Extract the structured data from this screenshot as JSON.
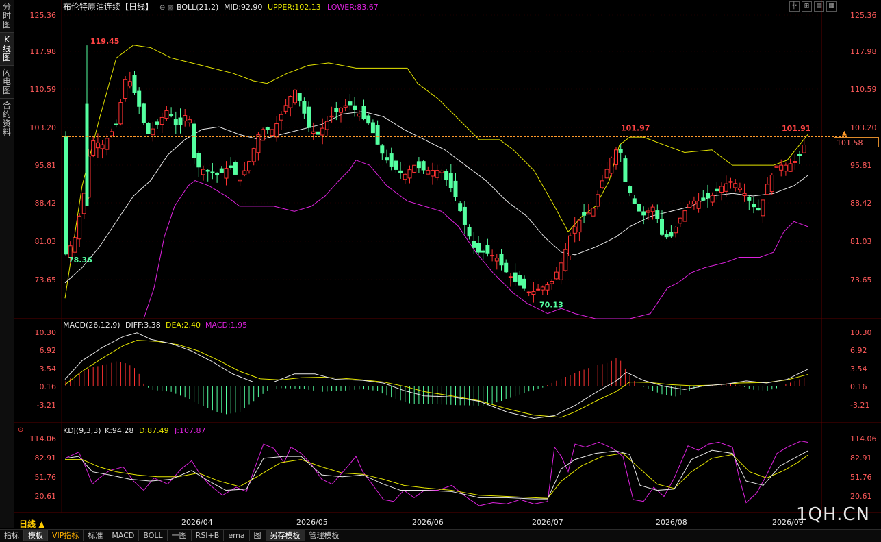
{
  "sidebar": [
    {
      "label": "分时图",
      "active": false
    },
    {
      "label": "K线图",
      "active": true
    },
    {
      "label": "闪电图",
      "active": false
    },
    {
      "label": "合约资料",
      "active": false
    }
  ],
  "main": {
    "instrument": "布伦特原油连续",
    "period_tag": "【日线】",
    "indicator_name": "BOLL(21,2)",
    "mid_label": "MID:92.90",
    "upper_label": "UPPER:102.13",
    "lower_label": "LOWER:83.67",
    "price_ticks": [
      "125.36",
      "117.98",
      "110.59",
      "103.20",
      "95.81",
      "88.42",
      "81.03",
      "73.65"
    ],
    "annotations": {
      "high1": "119.45",
      "low1": "78.36",
      "low2": "70.13",
      "high2": "101.97",
      "high3": "101.91"
    },
    "current_price": "101.58"
  },
  "macd": {
    "name": "MACD(26,12,9)",
    "diff": "DIFF:3.38",
    "dea": "DEA:2.40",
    "macd": "MACD:1.95",
    "ticks": [
      "10.30",
      "6.92",
      "3.54",
      "0.16",
      "-3.21"
    ]
  },
  "kdj": {
    "name": "KDJ(9,3,3)",
    "k": "K:94.28",
    "d": "D:87.49",
    "j": "J:107.87",
    "ticks": [
      "114.06",
      "82.91",
      "51.76",
      "20.61"
    ]
  },
  "x_axis": [
    "2026/04",
    "2026/05",
    "2026/06",
    "2026/07",
    "2026/08",
    "2026/09"
  ],
  "period_button": "日线 ▲",
  "bottom_tabs": [
    {
      "label": "指标"
    },
    {
      "label": "模板",
      "active": true
    },
    {
      "label": "VIP指标",
      "vip": true
    },
    {
      "label": "标准"
    },
    {
      "label": "MACD"
    },
    {
      "label": "BOLL"
    },
    {
      "label": "一图"
    },
    {
      "label": "RSI+B"
    },
    {
      "label": "ema"
    },
    {
      "label": "图"
    },
    {
      "label": "另存模板",
      "active": true
    },
    {
      "label": "管理模板"
    }
  ],
  "watermark": "1QH.CN",
  "colors": {
    "up": "#ff3232",
    "down": "#54ffa0",
    "mid": "#e8e8e8",
    "upper": "#e6e600",
    "lower": "#dd22dd",
    "label_red": "#ff4444",
    "label_green": "#54ffa0",
    "axis_red": "#ff5a5a",
    "grid": "#2a0000"
  }
}
